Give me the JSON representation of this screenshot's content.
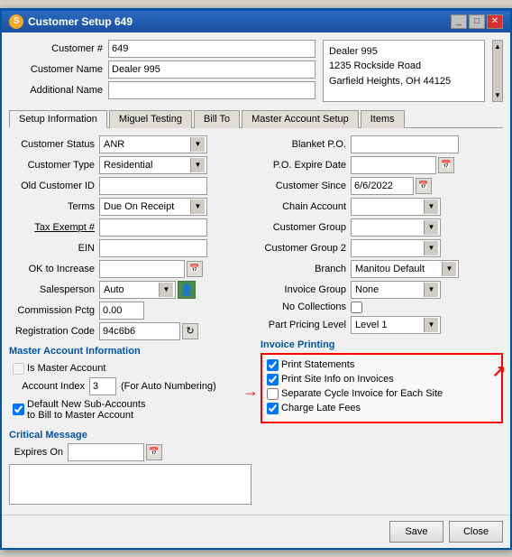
{
  "window": {
    "title": "Customer Setup 649",
    "icon": "S"
  },
  "customer": {
    "number_label": "Customer #",
    "number_value": "649",
    "name_label": "Customer Name",
    "name_value": "Dealer 995",
    "additional_name_label": "Additional Name",
    "additional_name_value": "",
    "info_line1": "Dealer 995",
    "info_line2": "1235 Rockside Road",
    "info_line3": "Garfield Heights, OH  44125"
  },
  "tabs": [
    {
      "label": "Setup Information",
      "active": true
    },
    {
      "label": "Miguel Testing",
      "active": false
    },
    {
      "label": "Bill To",
      "active": false
    },
    {
      "label": "Master Account Setup",
      "active": false
    },
    {
      "label": "Items",
      "active": false
    }
  ],
  "left_fields": {
    "customer_status_label": "Customer Status",
    "customer_status_value": "ANR",
    "customer_type_label": "Customer Type",
    "customer_type_value": "Residential",
    "old_customer_id_label": "Old Customer ID",
    "old_customer_id_value": "",
    "terms_label": "Terms",
    "terms_value": "Due On Receipt",
    "tax_exempt_label": "Tax Exempt #",
    "tax_exempt_value": "",
    "ein_label": "EIN",
    "ein_value": "",
    "ok_to_increase_label": "OK to Increase",
    "ok_to_increase_value": "",
    "salesperson_label": "Salesperson",
    "salesperson_value": "Auto",
    "commission_pctg_label": "Commission Pctg",
    "commission_pctg_value": "0.00",
    "registration_code_label": "Registration Code",
    "registration_code_value": "94c6b6"
  },
  "right_fields": {
    "blanket_po_label": "Blanket P.O.",
    "blanket_po_value": "",
    "po_expire_date_label": "P.O. Expire Date",
    "po_expire_date_value": "",
    "customer_since_label": "Customer Since",
    "customer_since_value": "6/6/2022",
    "chain_account_label": "Chain Account",
    "chain_account_value": "",
    "customer_group_label": "Customer Group",
    "customer_group_value": "",
    "customer_group2_label": "Customer Group 2",
    "customer_group2_value": "",
    "branch_label": "Branch",
    "branch_value": "Manitou Default",
    "invoice_group_label": "Invoice Group",
    "invoice_group_value": "None",
    "no_collections_label": "No Collections",
    "part_pricing_level_label": "Part Pricing Level",
    "part_pricing_level_value": "Level 1"
  },
  "master_account": {
    "section_title": "Master Account Information",
    "is_master_label": "Is Master Account",
    "account_index_label": "Account Index",
    "account_index_value": "3",
    "for_auto_numbering": "(For Auto Numbering)",
    "default_sub_accounts_label": "Default New Sub-Accounts",
    "default_sub_accounts_label2": "to Bill to Master Account"
  },
  "invoice_printing": {
    "section_title": "Invoice Printing",
    "print_statements_label": "Print Statements",
    "print_statements_checked": true,
    "print_site_info_label": "Print Site Info on Invoices",
    "print_site_info_checked": true,
    "separate_cycle_label": "Separate Cycle Invoice for Each Site",
    "separate_cycle_checked": false,
    "charge_late_fees_label": "Charge Late Fees",
    "charge_late_fees_checked": true
  },
  "critical_message": {
    "section_title": "Critical Message",
    "expires_on_label": "Expires On",
    "expires_on_value": ""
  },
  "buttons": {
    "save_label": "Save",
    "close_label": "Close"
  }
}
